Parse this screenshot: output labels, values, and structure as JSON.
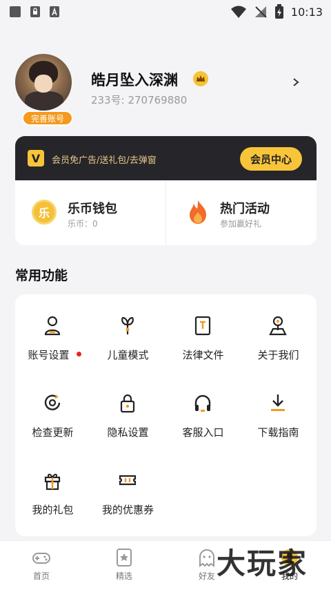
{
  "status_bar": {
    "time": "10:13"
  },
  "profile": {
    "username": "皓月坠入深渊",
    "user_id": "233号: 270769880",
    "complete_account_badge": "完善账号"
  },
  "vip": {
    "logo_text": "V",
    "description": "会员免广告/送礼包/去弹窗",
    "button_label": "会员中心"
  },
  "wallet": {
    "icon_text": "乐",
    "title": "乐币钱包",
    "subtitle": "乐币：0"
  },
  "activity": {
    "title": "热门活动",
    "subtitle": "参加赢好礼"
  },
  "common_functions": {
    "title": "常用功能",
    "items": [
      {
        "label": "账号设置",
        "icon": "user-icon",
        "has_dot": true
      },
      {
        "label": "儿童模式",
        "icon": "sprout-icon"
      },
      {
        "label": "法律文件",
        "icon": "document-icon"
      },
      {
        "label": "关于我们",
        "icon": "location-pin-icon"
      },
      {
        "label": "检查更新",
        "icon": "update-icon"
      },
      {
        "label": "隐私设置",
        "icon": "lock-icon"
      },
      {
        "label": "客服入口",
        "icon": "headphones-icon"
      },
      {
        "label": "下载指南",
        "icon": "download-icon"
      },
      {
        "label": "我的礼包",
        "icon": "gift-icon"
      },
      {
        "label": "我的优惠券",
        "icon": "coupon-icon"
      }
    ]
  },
  "tab_bar": {
    "tabs": [
      {
        "label": "首页",
        "icon": "gamepad-icon"
      },
      {
        "label": "精选",
        "icon": "star-card-icon"
      },
      {
        "label": "好友",
        "icon": "ghost-icon"
      },
      {
        "label": "我的",
        "icon": "profile-icon"
      }
    ]
  },
  "watermark": "大玩家",
  "colors": {
    "accent": "#f8c43a",
    "orange": "#f39a1f",
    "dark": "#262529"
  }
}
